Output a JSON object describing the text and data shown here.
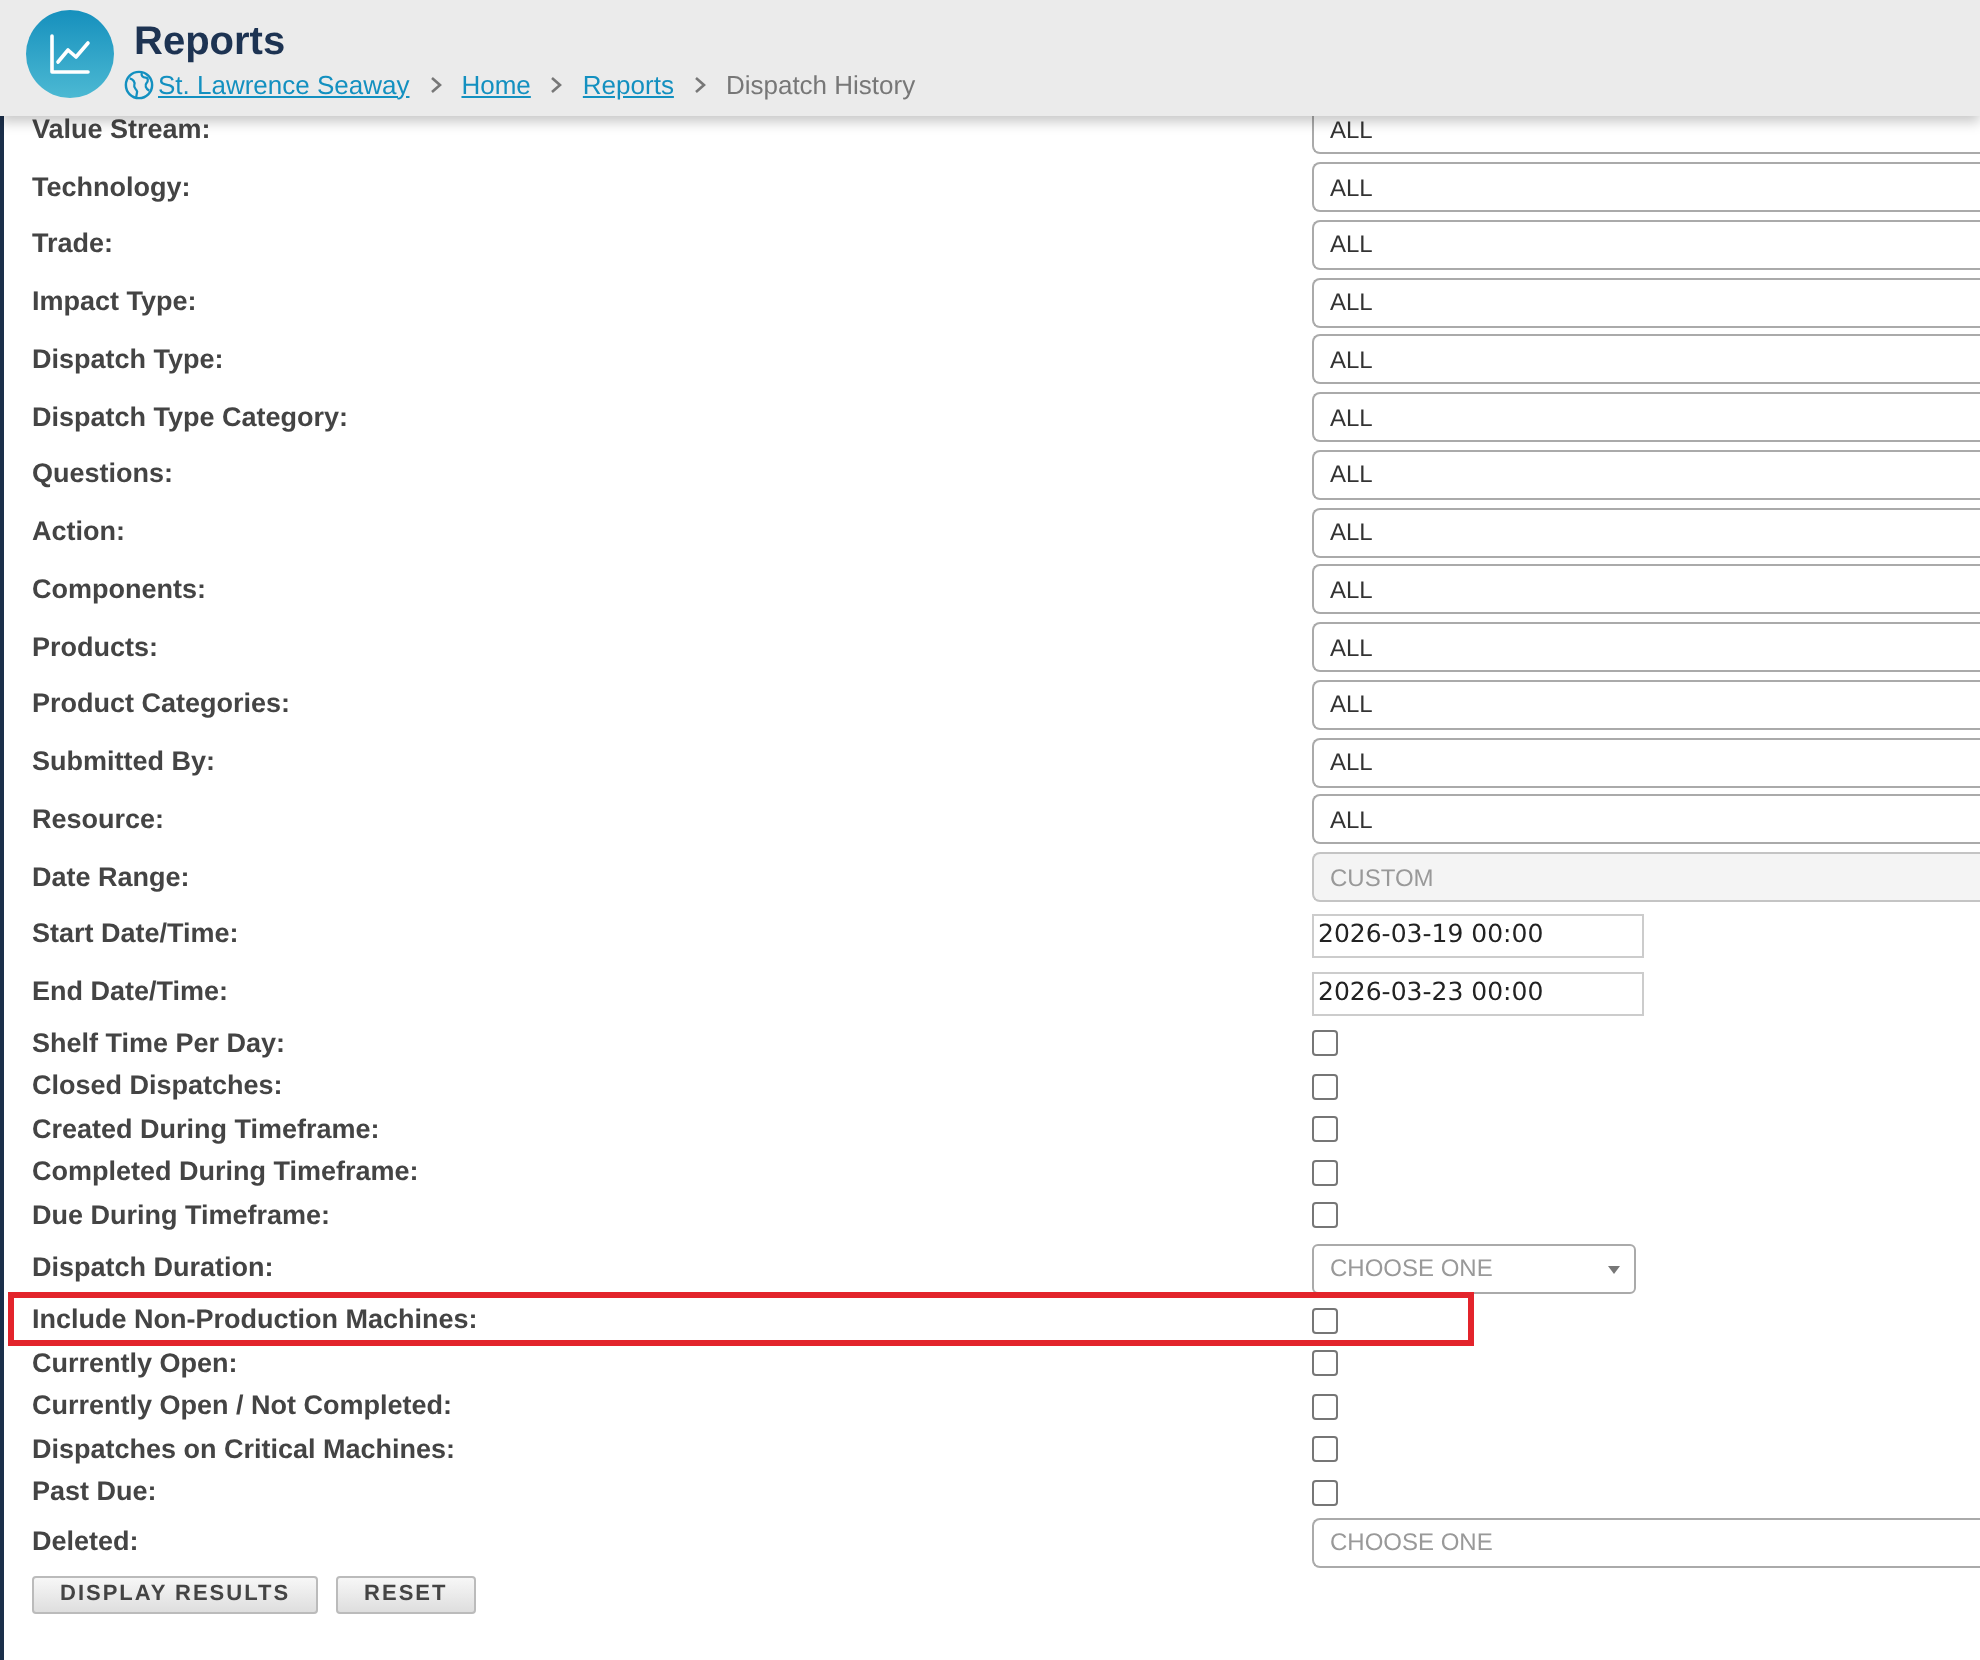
{
  "header": {
    "title": "Reports",
    "breadcrumb": [
      {
        "label": "St. Lawrence Seaway",
        "kind": "site"
      },
      {
        "label": "Home",
        "kind": "link"
      },
      {
        "label": "Reports",
        "kind": "link"
      },
      {
        "label": "Dispatch History",
        "kind": "current"
      }
    ]
  },
  "filters": [
    {
      "label": "Value Stream:",
      "kind": "select",
      "value": "ALL",
      "disabled": false,
      "highlighted": false
    },
    {
      "label": "Technology:",
      "kind": "select",
      "value": "ALL",
      "disabled": false,
      "highlighted": false
    },
    {
      "label": "Trade:",
      "kind": "select",
      "value": "ALL",
      "disabled": false,
      "highlighted": false
    },
    {
      "label": "Impact Type:",
      "kind": "select",
      "value": "ALL",
      "disabled": false,
      "highlighted": false
    },
    {
      "label": "Dispatch Type:",
      "kind": "select",
      "value": "ALL",
      "disabled": false,
      "highlighted": false
    },
    {
      "label": "Dispatch Type Category:",
      "kind": "select",
      "value": "ALL",
      "disabled": false,
      "highlighted": false
    },
    {
      "label": "Questions:",
      "kind": "select",
      "value": "ALL",
      "disabled": false,
      "highlighted": false
    },
    {
      "label": "Action:",
      "kind": "select",
      "value": "ALL",
      "disabled": false,
      "highlighted": false
    },
    {
      "label": "Components:",
      "kind": "select",
      "value": "ALL",
      "disabled": false,
      "highlighted": false
    },
    {
      "label": "Products:",
      "kind": "select",
      "value": "ALL",
      "disabled": false,
      "highlighted": false
    },
    {
      "label": "Product Categories:",
      "kind": "select",
      "value": "ALL",
      "disabled": false,
      "highlighted": false
    },
    {
      "label": "Submitted By:",
      "kind": "select",
      "value": "ALL",
      "disabled": false,
      "highlighted": false
    },
    {
      "label": "Resource:",
      "kind": "select",
      "value": "ALL",
      "disabled": false,
      "highlighted": false
    },
    {
      "label": "Date Range:",
      "kind": "select",
      "value": "CUSTOM",
      "disabled": true,
      "highlighted": false
    },
    {
      "label": "Start Date/Time:",
      "kind": "text",
      "value": "2026-03-19 00:00",
      "highlighted": false
    },
    {
      "label": "End Date/Time:",
      "kind": "text",
      "value": "2026-03-23 00:00",
      "highlighted": false
    },
    {
      "label": "Shelf Time Per Day:",
      "kind": "checkbox",
      "checked": false,
      "highlighted": false
    },
    {
      "label": "Closed Dispatches:",
      "kind": "checkbox",
      "checked": false,
      "highlighted": false
    },
    {
      "label": "Created During Timeframe:",
      "kind": "checkbox",
      "checked": false,
      "highlighted": false
    },
    {
      "label": "Completed During Timeframe:",
      "kind": "checkbox",
      "checked": false,
      "highlighted": false
    },
    {
      "label": "Due During Timeframe:",
      "kind": "checkbox",
      "checked": false,
      "highlighted": false
    },
    {
      "label": "Dispatch Duration:",
      "kind": "dropdown",
      "placeholder": "CHOOSE ONE",
      "highlighted": false
    },
    {
      "label": "Include Non-Production Machines:",
      "kind": "checkbox",
      "checked": false,
      "highlighted": true
    },
    {
      "label": "Currently Open:",
      "kind": "checkbox",
      "checked": false,
      "highlighted": false
    },
    {
      "label": "Currently Open / Not Completed:",
      "kind": "checkbox",
      "checked": false,
      "highlighted": false
    },
    {
      "label": "Dispatches on Critical Machines:",
      "kind": "checkbox",
      "checked": false,
      "highlighted": false
    },
    {
      "label": "Past Due:",
      "kind": "checkbox",
      "checked": false,
      "highlighted": false
    },
    {
      "label": "Deleted:",
      "kind": "select",
      "placeholder": "CHOOSE ONE",
      "disabled": false,
      "highlighted": false
    }
  ],
  "buttons": [
    "DISPLAY RESULTS",
    "RESET"
  ]
}
